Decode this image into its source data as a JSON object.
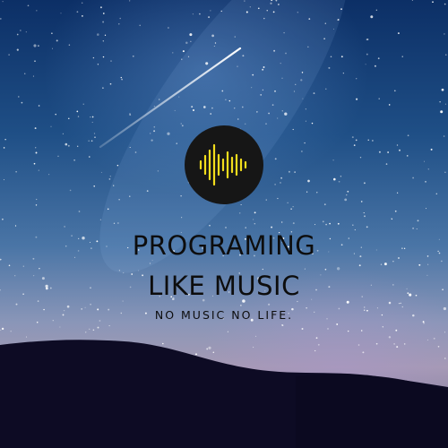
{
  "poster": {
    "title_line1": "PROGRAMING",
    "title_line2": "LIKE MUSIC",
    "tagline": "NO MUSIC NO LIFE."
  },
  "logo": {
    "icon": "sound-wave-icon",
    "circle_color": "#161616",
    "wave_color": "#f2dd1c"
  },
  "colors": {
    "sky_top": "#0c2f66",
    "horizon_glow": "#a59ab3",
    "hills": "#0d0b24",
    "text": "#0d0d0d"
  }
}
